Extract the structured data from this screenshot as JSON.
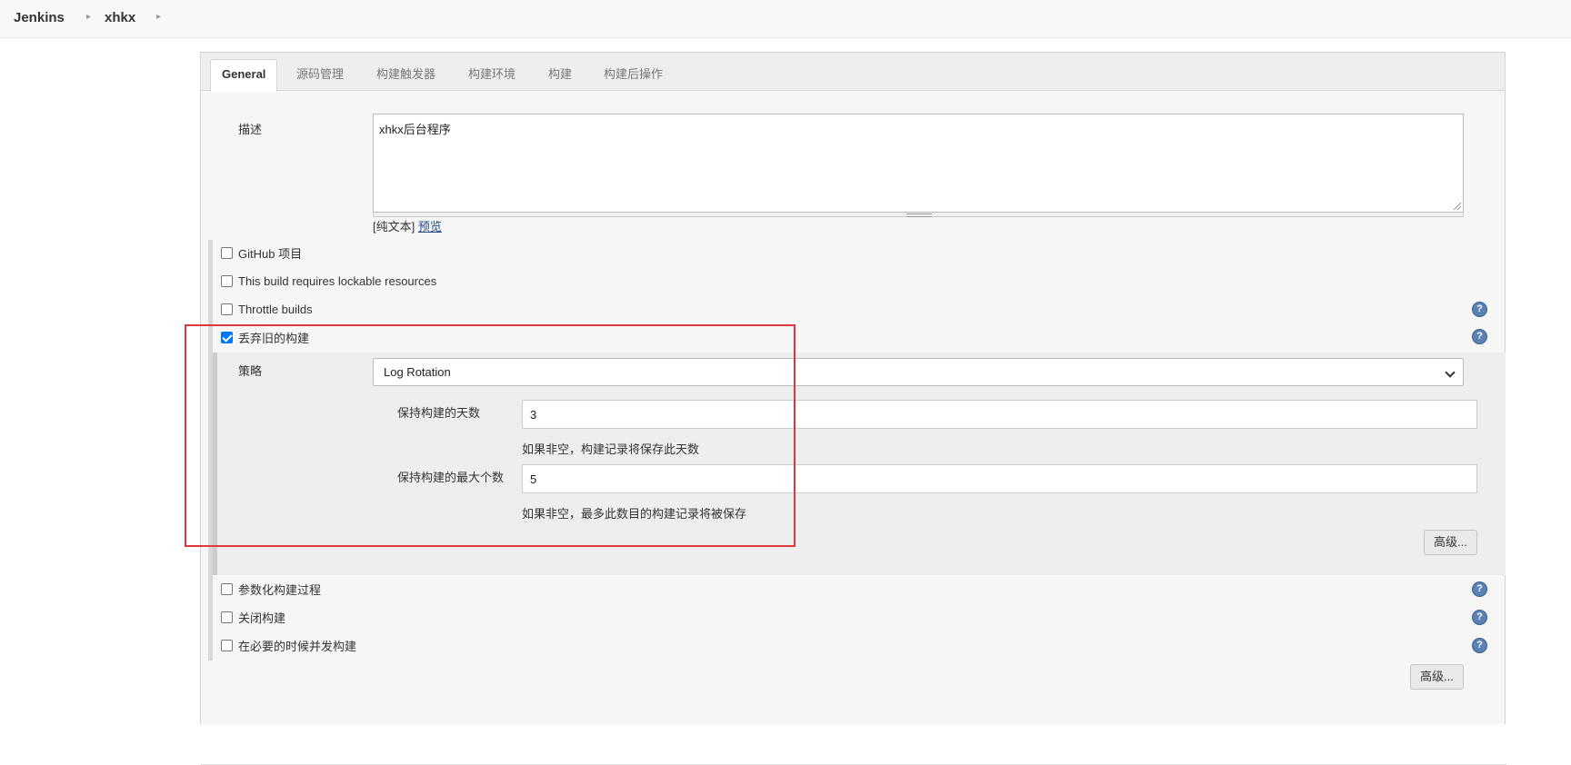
{
  "breadcrumb": {
    "items": [
      "Jenkins",
      "xhkx"
    ],
    "separator": "▸"
  },
  "tabs": [
    {
      "label": "General",
      "active": true
    },
    {
      "label": "源码管理",
      "active": false
    },
    {
      "label": "构建触发器",
      "active": false
    },
    {
      "label": "构建环境",
      "active": false
    },
    {
      "label": "构建",
      "active": false
    },
    {
      "label": "构建后操作",
      "active": false
    }
  ],
  "description": {
    "label": "描述",
    "value": "xhkx后台程序",
    "format_prefix": "[纯文本]",
    "preview_link": "预览"
  },
  "checkboxes": {
    "github": {
      "label": "GitHub 项目",
      "checked": false
    },
    "lockable": {
      "label": "This build requires lockable resources",
      "checked": false
    },
    "throttle": {
      "label": "Throttle builds",
      "checked": false
    },
    "discard": {
      "label": "丢弃旧的构建",
      "checked": true
    },
    "parameterized": {
      "label": "参数化构建过程",
      "checked": false
    },
    "disable": {
      "label": "关闭构建",
      "checked": false
    },
    "concurrent": {
      "label": "在必要的时候并发构建",
      "checked": false
    }
  },
  "strategy": {
    "label": "策略",
    "selected": "Log Rotation"
  },
  "days_to_keep": {
    "label": "保持构建的天数",
    "value": "3",
    "hint": "如果非空，构建记录将保存此天数"
  },
  "max_builds": {
    "label": "保持构建的最大个数",
    "value": "5",
    "hint": "如果非空，最多此数目的构建记录将被保存"
  },
  "buttons": {
    "advanced_inner": "高级...",
    "advanced_outer": "高级..."
  },
  "help_icon": "?",
  "colors": {
    "highlight_box": "#e0373c",
    "checkbox_checked": "#0075ff",
    "help_icon": "#5b82b5"
  }
}
